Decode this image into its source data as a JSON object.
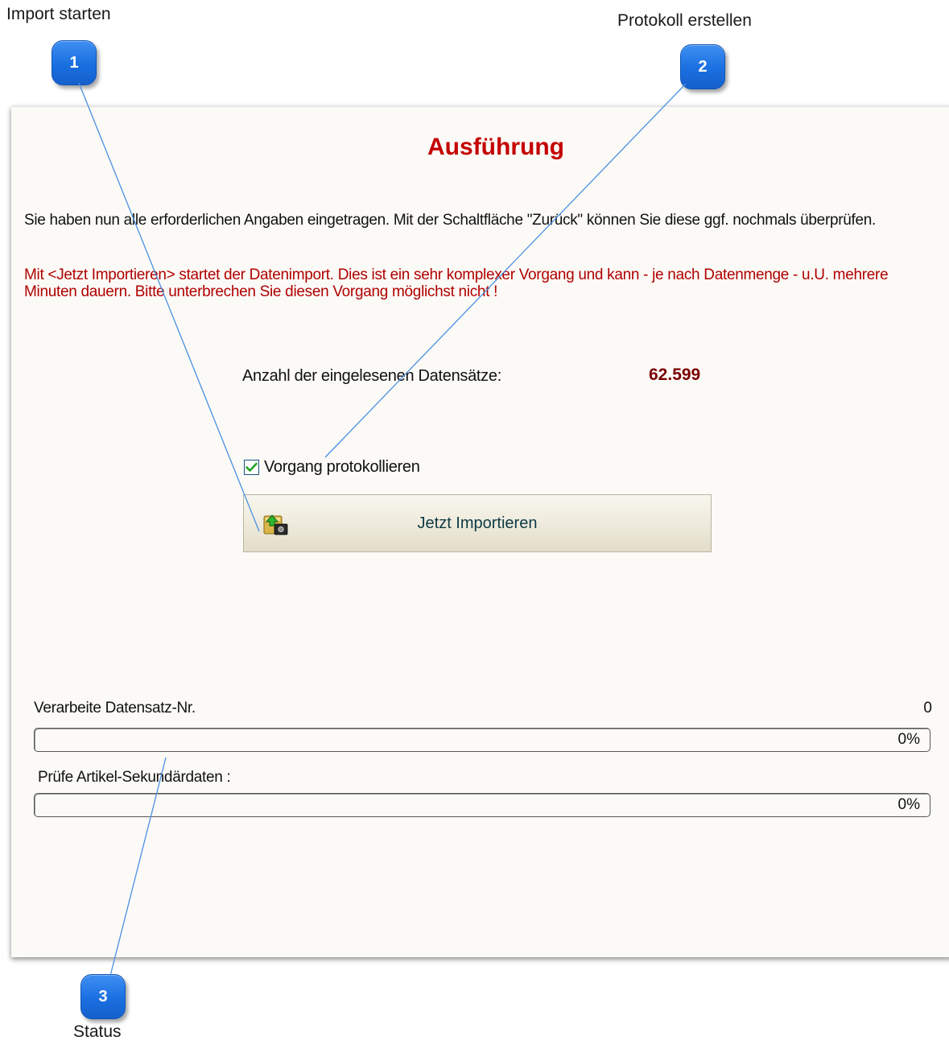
{
  "callouts": [
    {
      "number": "1",
      "label": "Import starten"
    },
    {
      "number": "2",
      "label": "Protokoll erstellen"
    },
    {
      "number": "3",
      "label": "Status"
    }
  ],
  "dialog": {
    "title": "Ausführung",
    "intro_text": "Sie haben nun alle erforderlichen Angaben eingetragen. Mit der Schaltfläche \"Zurück\" können Sie diese ggf. nochmals überprüfen.",
    "warning_text": "Mit <Jetzt Importieren> startet der Datenimport. Dies ist ein sehr komplexer Vorgang und kann - je nach Datenmenge - u.U. mehrere Minuten dauern. Bitte unterbrechen Sie diesen Vorgang möglichst nicht !",
    "record_count_label": "Anzahl der eingelesenen Datensätze:",
    "record_count_value": "62.599",
    "log_checkbox": {
      "label": "Vorgang protokollieren",
      "checked": true
    },
    "import_button": {
      "label": "Jetzt Importieren",
      "icon": "database-import-icon"
    },
    "progress": {
      "record": {
        "label": "Verarbeite Datensatz-Nr.",
        "current": "0",
        "percent_text": "0%",
        "fraction": 0
      },
      "secondary": {
        "label": "Prüfe Artikel-Sekundärdaten :",
        "percent_text": "0%",
        "fraction": 0
      }
    }
  },
  "colors": {
    "title": "#c40000",
    "warning": "#b00000",
    "count_value": "#7a0000",
    "callout_badge": "#1a6fe0",
    "leader_line": "#4a90e2",
    "panel_background": "#fbfaf6"
  }
}
